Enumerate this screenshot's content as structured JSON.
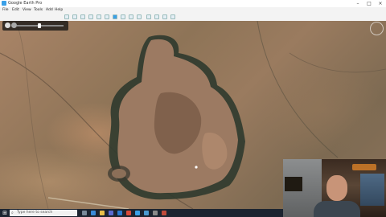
{
  "window": {
    "title": "Google Earth Pro"
  },
  "menubar": {
    "items": [
      "File",
      "Edit",
      "View",
      "Tools",
      "Add",
      "Help"
    ]
  },
  "toolbar": {
    "buttons": [
      "sidebar-icon",
      "placemark-icon",
      "polygon-icon",
      "path-icon",
      "overlay-icon",
      "tour-icon",
      "history-icon",
      "sun-icon",
      "planets-icon",
      "ruler-icon",
      "email-icon",
      "print-icon",
      "save-image-icon",
      "maps-icon"
    ]
  },
  "taskbar": {
    "search_placeholder": "Type here to search",
    "icons": [
      "task-view-icon",
      "edge-icon",
      "file-explorer-icon",
      "store-icon",
      "mail-icon",
      "chrome-icon",
      "google-earth-icon",
      "photos-icon",
      "settings-icon",
      "camera-icon"
    ]
  },
  "colors": {
    "terrain": "#8e7457",
    "crater_rim": "#2f3a2e",
    "taskbar": "#1c2430",
    "accent": "#3aa0e8"
  }
}
